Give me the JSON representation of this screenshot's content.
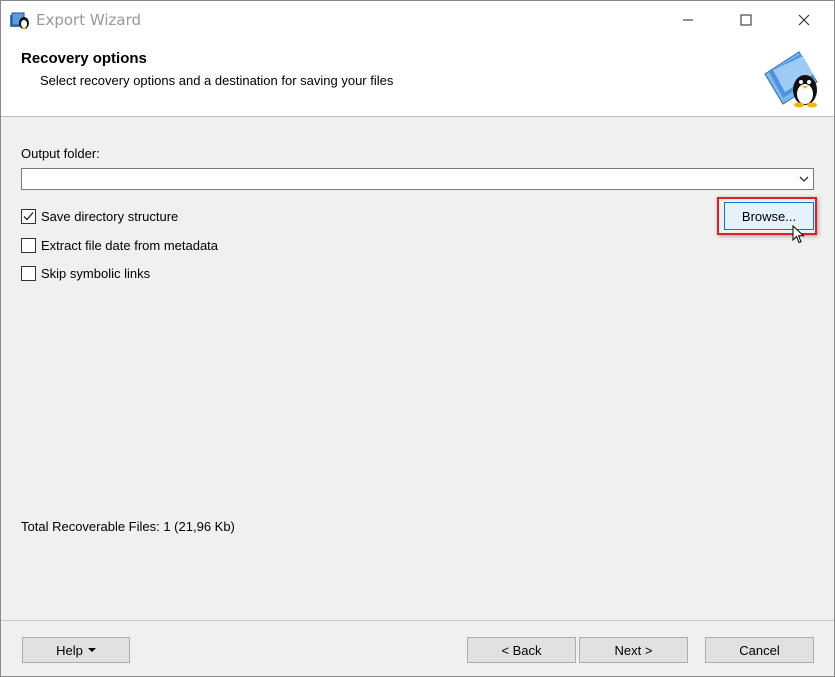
{
  "window": {
    "title": "Export Wizard"
  },
  "header": {
    "title": "Recovery options",
    "subtitle": "Select recovery options and a destination for saving your files"
  },
  "output": {
    "label": "Output folder:",
    "value": ""
  },
  "options": [
    {
      "label": "Save directory structure",
      "checked": true
    },
    {
      "label": "Extract file date from metadata",
      "checked": false
    },
    {
      "label": "Skip symbolic links",
      "checked": false
    }
  ],
  "browse_label": "Browse...",
  "status": {
    "total_files": "Total Recoverable Files: 1 (21,96 Kb)"
  },
  "footer": {
    "help_label": "Help",
    "back_label": "< Back",
    "next_label": "Next >",
    "cancel_label": "Cancel"
  },
  "colors": {
    "highlight": "#e31b23",
    "accent": "#0078d7"
  }
}
